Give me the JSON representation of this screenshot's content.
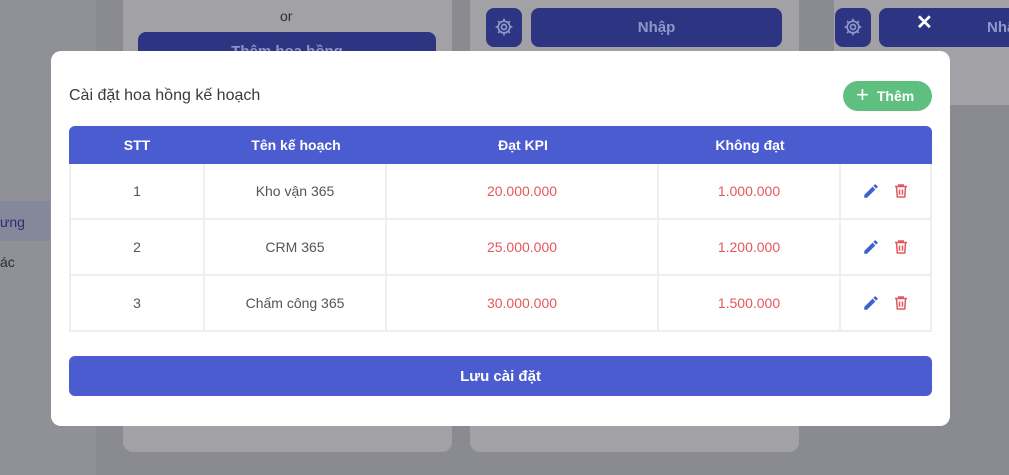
{
  "background": {
    "or_text": "or",
    "add_commission_label": "Thêm hoa hồng",
    "import_label": "Nhập",
    "import_label_2": "Nhậ",
    "close_symbol": "✕",
    "sidebar_active_fragment": "ưng",
    "sidebar_other_fragment": "ác"
  },
  "modal": {
    "title": "Cài đặt hoa hồng kế hoạch",
    "add_button_label": "Thêm",
    "columns": [
      "STT",
      "Tên kế hoạch",
      "Đạt KPI",
      "Không đạt",
      ""
    ],
    "rows": [
      {
        "stt": "1",
        "name": "Kho vận 365",
        "kpi": "20.000.000",
        "fail": "1.000.000"
      },
      {
        "stt": "2",
        "name": "CRM 365",
        "kpi": "25.000.000",
        "fail": "1.200.000"
      },
      {
        "stt": "3",
        "name": "Chấm công 365",
        "kpi": "30.000.000",
        "fail": "1.500.000"
      }
    ],
    "save_button_label": "Lưu cài đặt"
  },
  "colors": {
    "primary": "#4b5bd0",
    "success": "#5fbf7f",
    "money": "#e5575b",
    "edit_icon": "#3b63c9",
    "delete_icon": "#e5575b"
  },
  "icons": [
    "gear-icon",
    "close-icon",
    "plus-icon",
    "edit-icon",
    "trash-icon"
  ]
}
